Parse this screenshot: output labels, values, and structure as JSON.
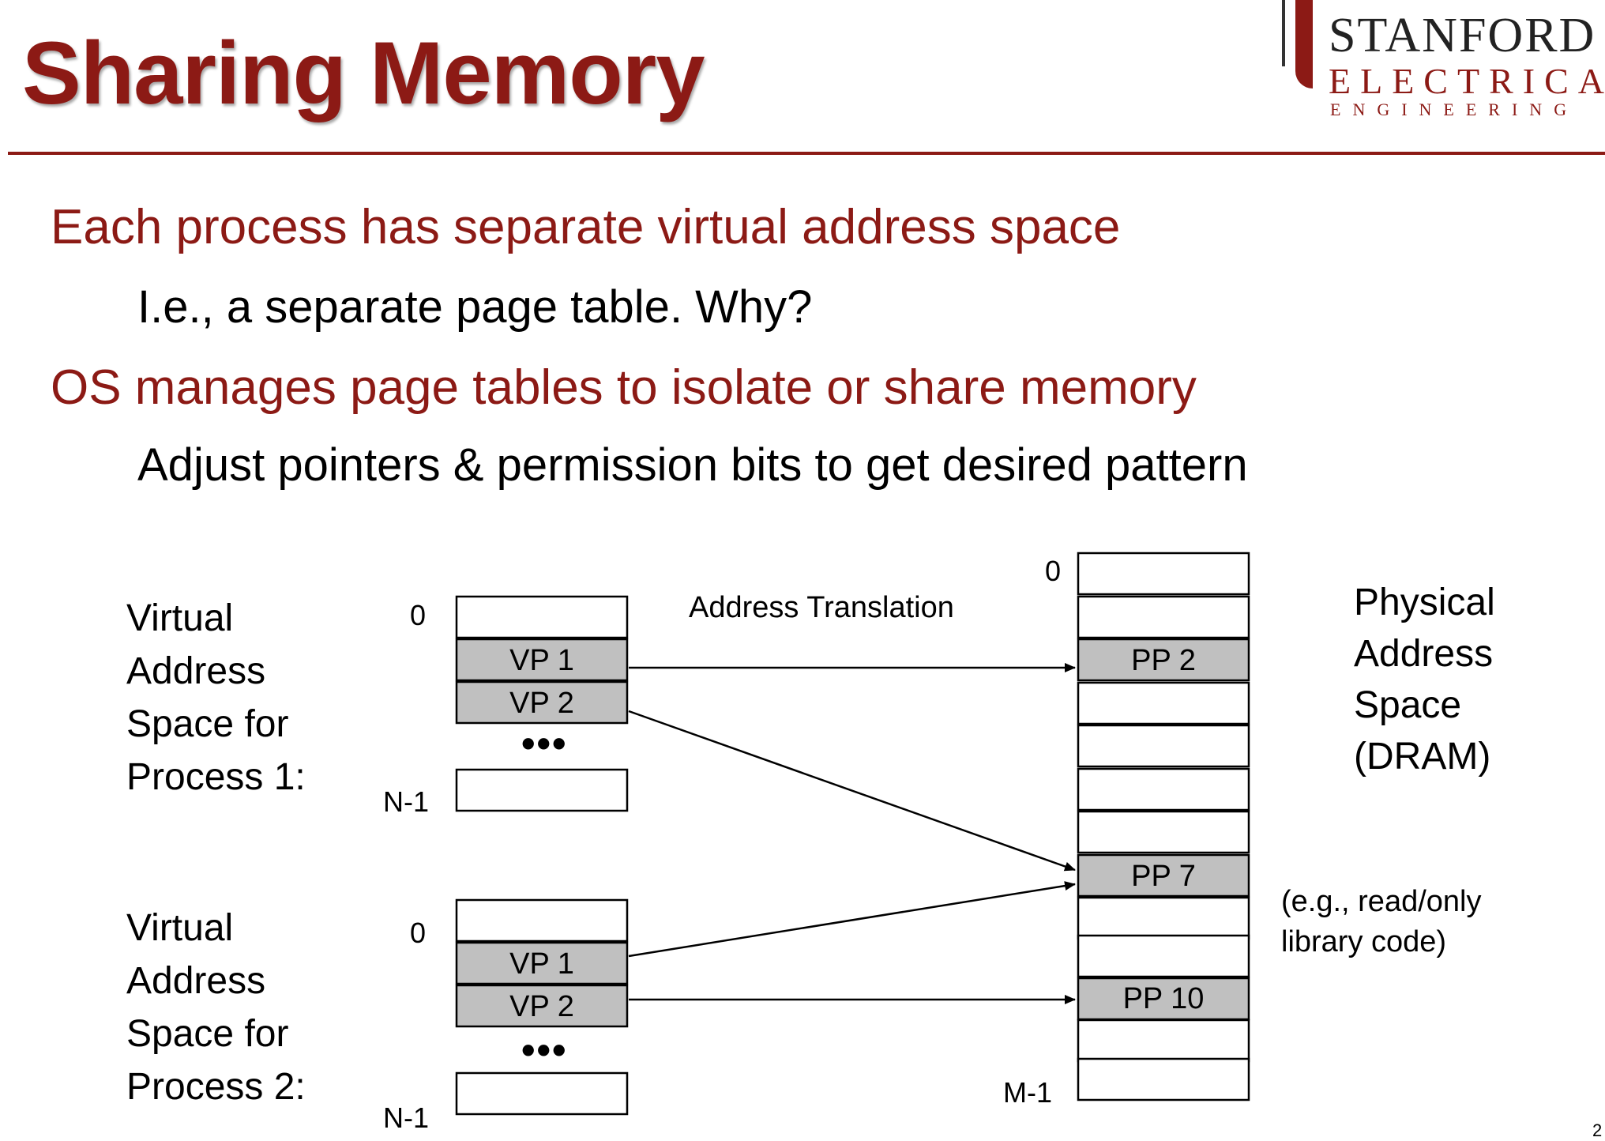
{
  "slide": {
    "title": "Sharing Memory",
    "logo": {
      "line1": "STANFORD",
      "line2": "ELECTRICAL",
      "line3": "ENGINEERING"
    },
    "bullets": [
      {
        "level": 1,
        "text": "Each process has separate virtual address space"
      },
      {
        "level": 2,
        "text": "I.e., a separate page table. Why?"
      },
      {
        "level": 1,
        "text": "OS manages page tables to isolate or share memory"
      },
      {
        "level": 2,
        "text": "Adjust pointers & permission bits to get desired pattern"
      }
    ],
    "page_number": "2"
  },
  "diagram": {
    "translation_label": "Address Translation",
    "process1": {
      "label_lines": [
        "Virtual",
        "Address",
        "Space for",
        "Process 1:"
      ],
      "start_index": "0",
      "end_index": "N-1",
      "pages": [
        "",
        "VP 1",
        "VP 2"
      ],
      "ellipsis": "•••"
    },
    "process2": {
      "label_lines": [
        "Virtual",
        "Address",
        "Space for",
        "Process 2:"
      ],
      "start_index": "0",
      "end_index": "N-1",
      "pages": [
        "",
        "VP 1",
        "VP 2"
      ],
      "ellipsis": "•••"
    },
    "physical": {
      "label_lines": [
        "Physical",
        "Address",
        "Space",
        "(DRAM)"
      ],
      "start_index": "0",
      "end_index": "M-1",
      "frames": [
        "",
        "",
        "PP 2",
        "",
        "",
        "",
        "",
        "PP 7",
        "",
        "",
        "PP 10",
        "",
        ""
      ],
      "note_lines": [
        "(e.g., read/only",
        "library code)"
      ]
    },
    "mappings": [
      {
        "from": "process1.VP 1",
        "to": "PP 2"
      },
      {
        "from": "process1.VP 2",
        "to": "PP 7"
      },
      {
        "from": "process2.VP 1",
        "to": "PP 7"
      },
      {
        "from": "process2.VP 2",
        "to": "PP 10"
      }
    ],
    "colors": {
      "title": "#8c1a15",
      "shaded_page": "#c0c0c0",
      "empty_page": "#ffffff"
    }
  }
}
